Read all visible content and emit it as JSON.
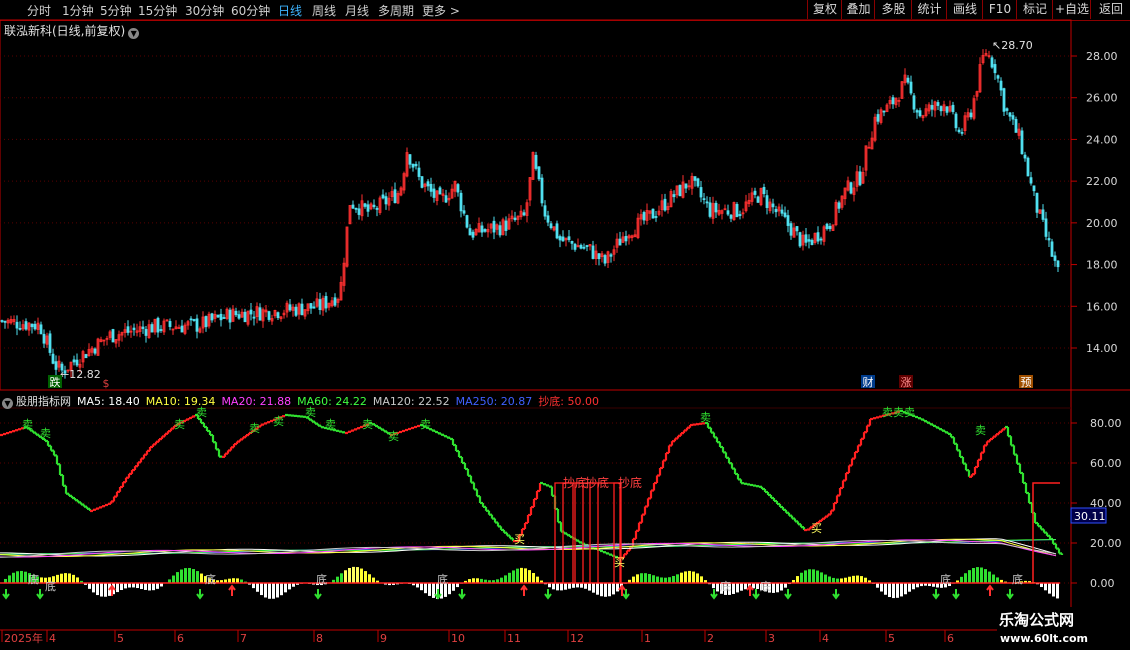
{
  "toolbar": {
    "tabs": [
      "分时",
      "1分钟",
      "5分钟",
      "15分钟",
      "30分钟",
      "60分钟",
      "日线",
      "周线",
      "月线",
      "多周期",
      "更多 >"
    ],
    "active_tab": "日线",
    "right_buttons": [
      "复权",
      "叠加",
      "多股",
      "统计",
      "画线",
      "F10",
      "标记",
      "+自选",
      "返回"
    ]
  },
  "main_chart": {
    "title": "联泓新科(日线,前复权)",
    "high_label": "28.70",
    "low_label": "12.82",
    "y_ticks": [
      "28.00",
      "26.00",
      "24.00",
      "22.00",
      "20.00",
      "18.00",
      "16.00",
      "14.00"
    ],
    "markers": {
      "die": "跌",
      "s": "$",
      "cai": "财",
      "zhang": "涨",
      "yu": "预"
    },
    "colors": {
      "up": "#ff3030",
      "down": "#50e0f0"
    }
  },
  "indicator": {
    "name": "股朋指标网",
    "ma": [
      {
        "label": "MA5: 18.40",
        "color": "#ffffff"
      },
      {
        "label": "MA10: 19.34",
        "color": "#ffff40"
      },
      {
        "label": "MA20: 21.88",
        "color": "#ff40ff"
      },
      {
        "label": "MA60: 24.22",
        "color": "#40ff40"
      },
      {
        "label": "MA120: 22.52",
        "color": "#c8c8c8"
      },
      {
        "label": "MA250: 20.87",
        "color": "#4060ff"
      },
      {
        "label": "抄底: 50.00",
        "color": "#ff3030"
      }
    ],
    "y_ticks": [
      "80.00",
      "60.00",
      "40.00",
      "20.00",
      "0.00"
    ],
    "current_value": "30.11",
    "labels": {
      "sell": "卖",
      "buy": "买",
      "bottom": "底",
      "chaodi": "抄底",
      "sellsell": "卖卖卖"
    }
  },
  "x_axis": {
    "months": [
      "2025年",
      "4",
      "5",
      "6",
      "7",
      "8",
      "9",
      "10",
      "11",
      "12",
      "1",
      "2",
      "3",
      "4",
      "5",
      "6"
    ]
  },
  "watermark": {
    "line1": "乐淘公式网",
    "line2": "www.60lt.com"
  }
}
